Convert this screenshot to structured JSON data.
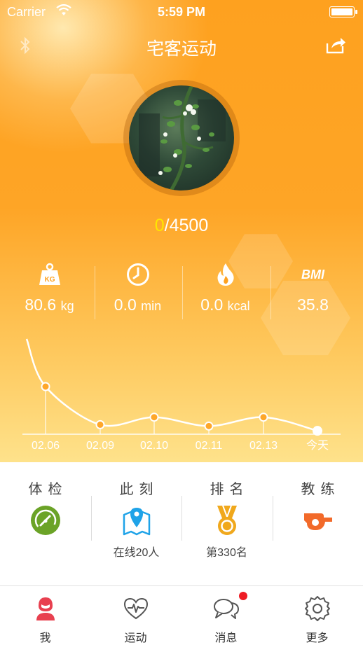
{
  "status_bar": {
    "carrier": "Carrier",
    "time": "5:59 PM"
  },
  "nav": {
    "title": "宅客运动",
    "left_icon": "bluetooth-icon",
    "right_icon": "share-icon"
  },
  "progress": {
    "current": "0",
    "total": "/4500"
  },
  "stats": [
    {
      "icon": "weight-kg-icon",
      "value": "80.6",
      "unit": "kg"
    },
    {
      "icon": "clock-icon",
      "value": "0.0",
      "unit": "min"
    },
    {
      "icon": "flame-icon",
      "value": "0.0",
      "unit": "kcal"
    },
    {
      "icon": "bmi-icon",
      "icon_text": "BMI",
      "value": "35.8",
      "unit": ""
    }
  ],
  "chart_data": {
    "type": "line",
    "categories": [
      "02.06",
      "02.09",
      "02.10",
      "02.11",
      "02.13",
      "今天"
    ],
    "values": [
      70,
      14,
      25,
      12,
      25,
      5
    ],
    "ylim": [
      0,
      140
    ],
    "grid": false
  },
  "features": [
    {
      "label": "体检",
      "icon": "speedometer-icon",
      "sub": ""
    },
    {
      "label": "此刻",
      "icon": "map-location-icon",
      "sub": "在线20人"
    },
    {
      "label": "排名",
      "icon": "medal-icon",
      "sub": "第330名"
    },
    {
      "label": "教练",
      "icon": "whistle-icon",
      "sub": ""
    }
  ],
  "tabs": [
    {
      "label": "我",
      "icon": "user-icon",
      "active": true
    },
    {
      "label": "运动",
      "icon": "heart-pulse-icon",
      "active": false
    },
    {
      "label": "消息",
      "icon": "chat-bubbles-icon",
      "active": false,
      "badge": true
    },
    {
      "label": "更多",
      "icon": "gear-icon",
      "active": false
    }
  ],
  "colors": {
    "accent": "#fea11f",
    "progress_current": "#ffe600",
    "badge": "#ee1c24",
    "user_red": "#e84050"
  }
}
